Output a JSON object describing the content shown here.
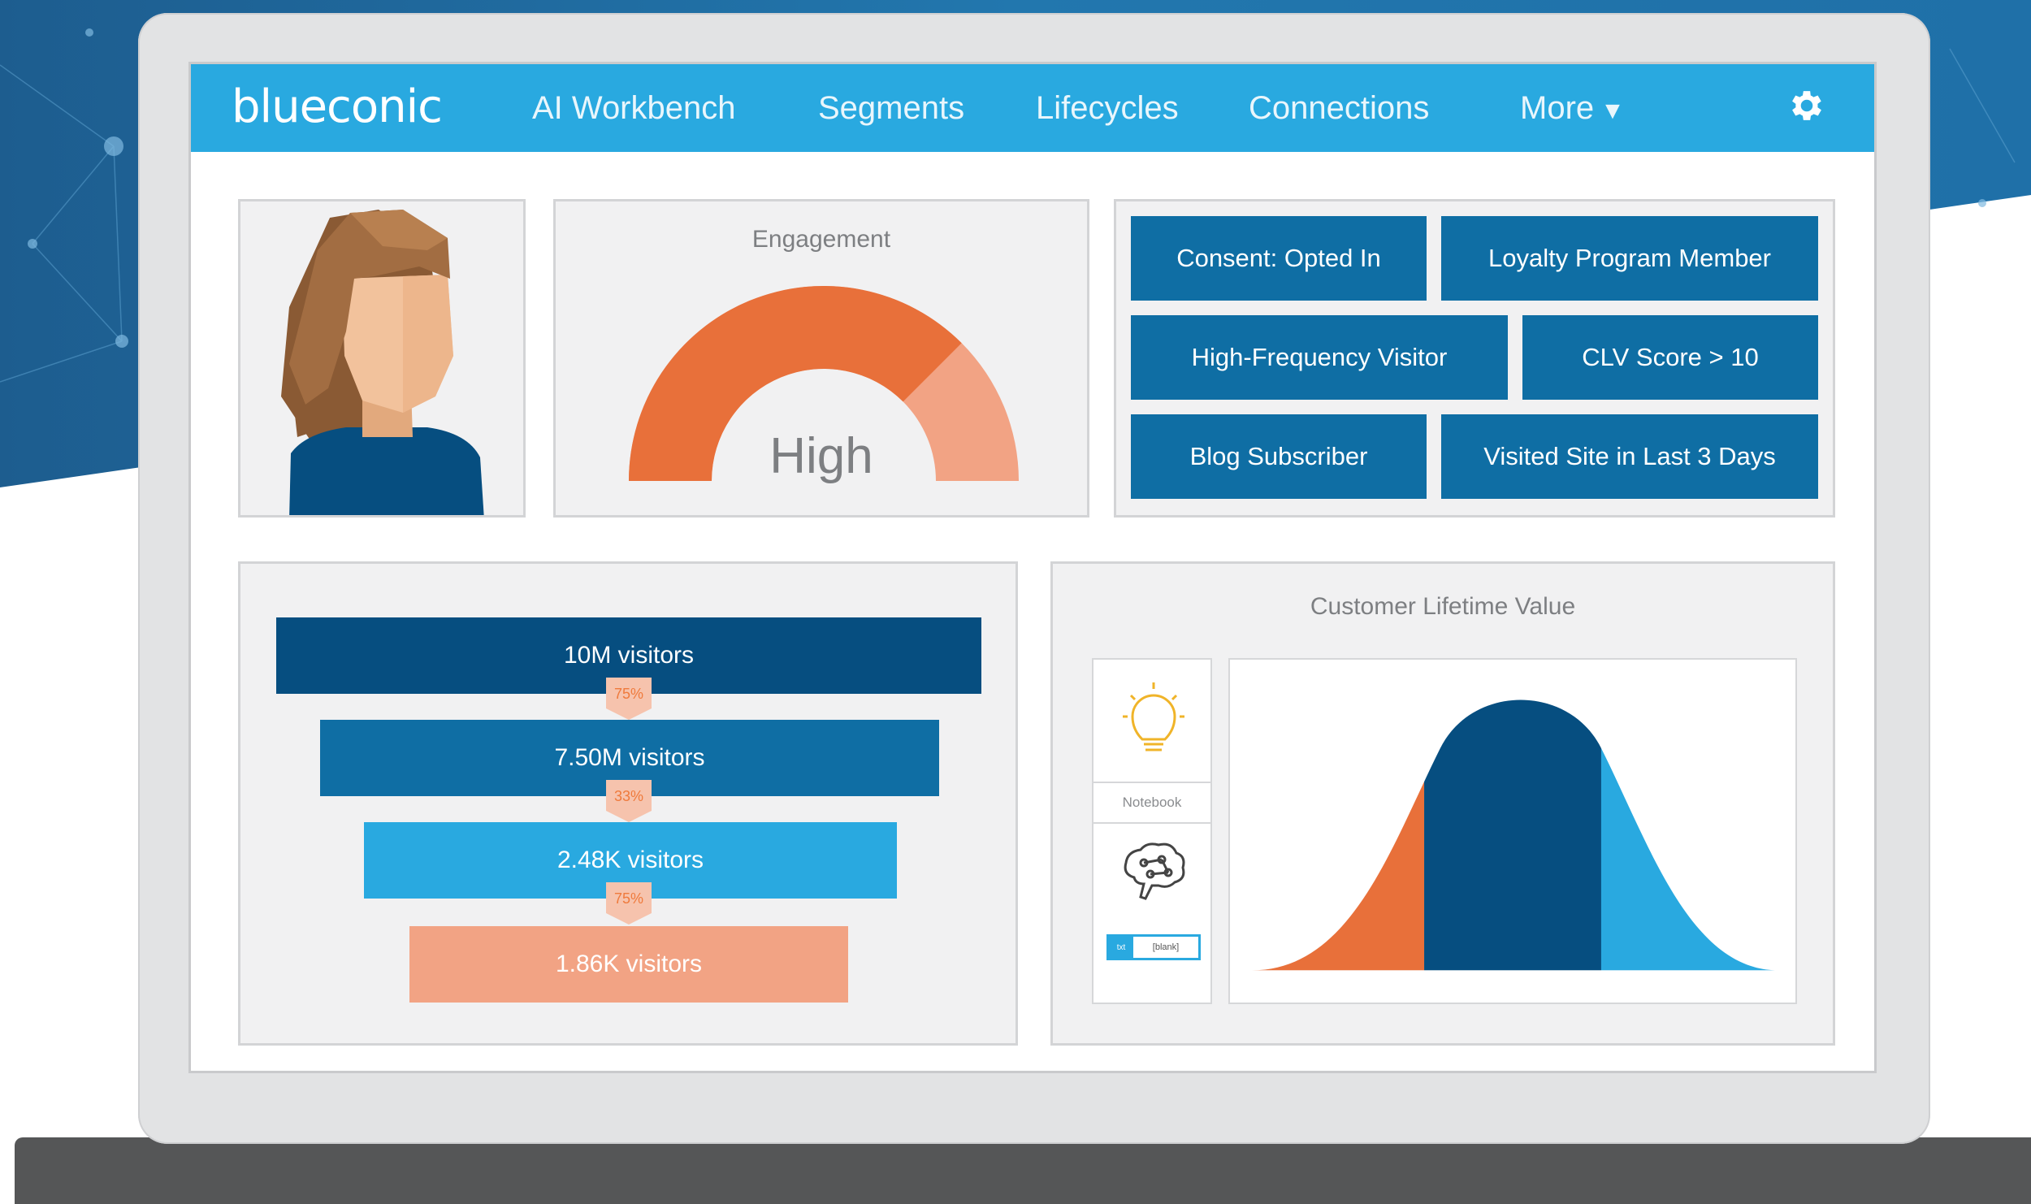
{
  "nav": {
    "logo": "blueconic",
    "items": [
      "AI Workbench",
      "Segments",
      "Lifecycles",
      "Connections",
      "More"
    ]
  },
  "icons": {
    "settings": "gear-icon",
    "more": "caret-down-icon",
    "lightbulb": "lightbulb-icon",
    "brain": "brain-icon",
    "avatar": "woman-avatar"
  },
  "engagement": {
    "title": "Engagement",
    "value": "High",
    "level": 0.75
  },
  "tags": [
    "Consent: Opted In",
    "Loyalty Program Member",
    "High-Frequency Visitor",
    "CLV Score > 10",
    "Blog Subscriber",
    "Visited Site in Last 3 Days"
  ],
  "funnel": {
    "stages": [
      "10M visitors",
      "7.50M visitors",
      "2.48K visitors",
      "1.86K visitors"
    ],
    "conversions": [
      "75%",
      "33%",
      "75%"
    ]
  },
  "clv": {
    "title": "Customer Lifetime Value",
    "notebook_label": "Notebook",
    "input_tag": "txt",
    "input_value": "[blank]"
  },
  "colors": {
    "nav": "#29a9e0",
    "dark_blue": "#064e80",
    "mid_blue": "#0f6ea4",
    "light_blue": "#29a9e0",
    "orange": "#e8703a",
    "salmon": "#f2a384",
    "hair": "#a26d42",
    "skin": "#f2c29c"
  }
}
